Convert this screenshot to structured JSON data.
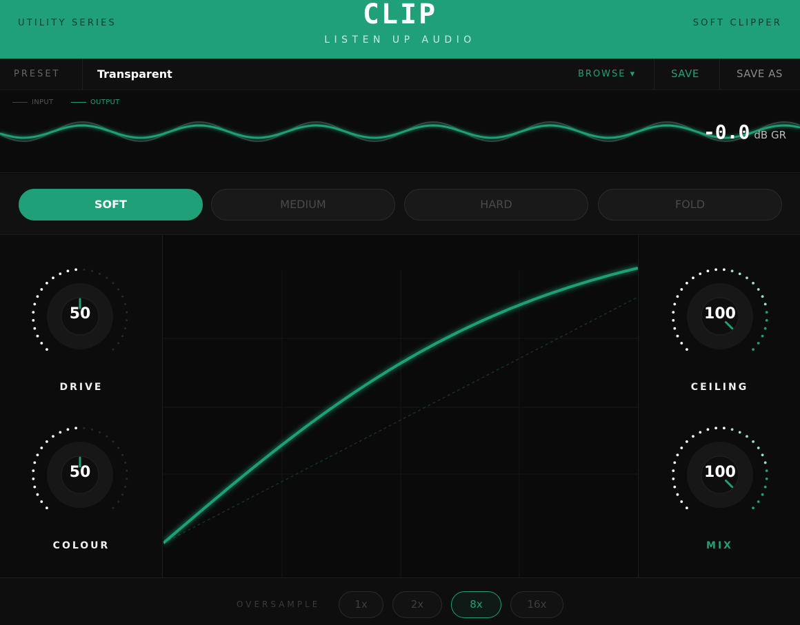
{
  "header": {
    "series": "UTILITY SERIES",
    "title": "CLIP",
    "vendor": "LISTEN UP AUDIO",
    "product_type": "SOFT CLIPPER"
  },
  "preset": {
    "label": "PRESET",
    "name": "Transparent",
    "browse": "BROWSE ▾",
    "save": "SAVE",
    "save_as": "SAVE AS"
  },
  "scope": {
    "legend_input": "INPUT",
    "legend_output": "OUTPUT",
    "gain_reduction": "-0.0",
    "gain_reduction_unit": "dB GR"
  },
  "modes": {
    "items": [
      "SOFT",
      "MEDIUM",
      "HARD",
      "FOLD"
    ],
    "selected": "SOFT"
  },
  "knobs": {
    "drive": {
      "label": "DRIVE",
      "value": "50",
      "percent": 50
    },
    "colour": {
      "label": "COLOUR",
      "value": "50",
      "percent": 50
    },
    "ceiling": {
      "label": "CEILING",
      "value": "100",
      "percent": 100
    },
    "mix": {
      "label": "MIX",
      "value": "100",
      "percent": 100
    }
  },
  "oversample": {
    "label": "OVERSAMPLE",
    "options": [
      "1x",
      "2x",
      "8x",
      "16x"
    ],
    "selected": "8x"
  },
  "colors": {
    "accent": "#1fa078",
    "background": "#0b0b0b",
    "inactive": "#4a4a4a"
  },
  "icons": {
    "browse_caret": "caret-down-icon"
  }
}
